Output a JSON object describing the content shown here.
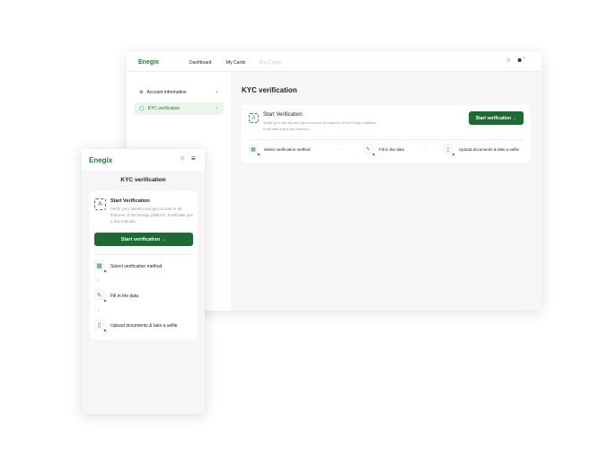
{
  "brand": "Enegix",
  "desktop": {
    "nav": [
      "Dashboard",
      "My Cards",
      "Buy Crypto"
    ],
    "sidebar": [
      {
        "label": "Account information",
        "icon": "gear-icon"
      },
      {
        "label": "KYC verification",
        "icon": "shield-icon"
      }
    ],
    "title": "KYC verification",
    "card": {
      "title": "Start Verification",
      "desc1": "Verify your identity and get access to all features of the Enegix platform.",
      "desc2": "It will take just a few minutes.",
      "button": "Start verification"
    },
    "steps": [
      "Select verification method",
      "Fill in the data",
      "Upload documents & take a selfie"
    ]
  },
  "mobile": {
    "title": "KYC verification",
    "card": {
      "title": "Start Verification",
      "desc": "Verify your identity and get access to all features of the Enegix platform. It will take just a few minutes.",
      "button": "Start verification"
    },
    "steps": [
      "Select verification method",
      "Fill in the data",
      "Upload documents & take a selfie"
    ]
  },
  "colors": {
    "accent": "#1b6b33",
    "brand": "#1f7a3a",
    "alert": "#e33333"
  }
}
